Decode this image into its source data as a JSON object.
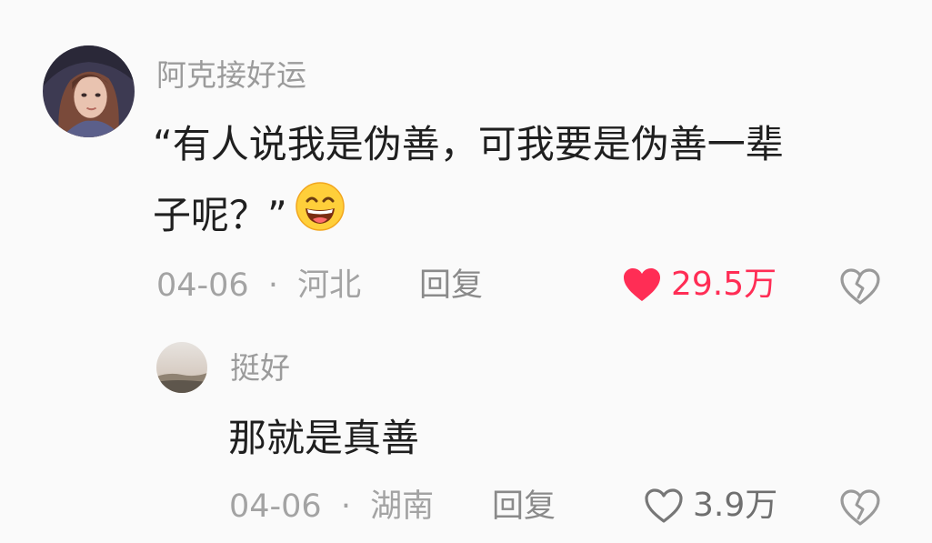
{
  "comment": {
    "username": "阿克接好运",
    "text_line1": "“有人说我是伪善，可我要是伪善一辈",
    "text_line2": "子呢？”",
    "emoji_icon": "grinning-face-emoji",
    "date": "04-06",
    "separator": "·",
    "location": "河北",
    "reply_label": "回复",
    "likes": "29.5万",
    "liked": true,
    "like_color": "#ff2d55"
  },
  "reply": {
    "username": "挺好",
    "text": "那就是真善",
    "date": "04-06",
    "separator": "·",
    "location": "湖南",
    "reply_label": "回复",
    "likes": "3.9万",
    "liked": false
  }
}
